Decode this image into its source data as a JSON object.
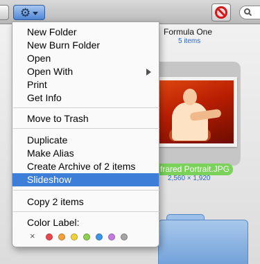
{
  "folder": {
    "name": "Formula One",
    "count": "5 items"
  },
  "hidden_text": "ts",
  "file": {
    "label": "frared Portrait.JPG",
    "dimensions": "2,560 × 1,920"
  },
  "menu": {
    "items": [
      {
        "label": "New Folder"
      },
      {
        "label": "New Burn Folder"
      },
      {
        "label": "Open"
      },
      {
        "label": "Open With",
        "submenu": true
      },
      {
        "label": "Print"
      },
      {
        "label": "Get Info"
      },
      {
        "label": "Move to Trash"
      },
      {
        "label": "Duplicate"
      },
      {
        "label": "Make Alias"
      },
      {
        "label": "Create Archive of 2 items"
      },
      {
        "label": "Slideshow",
        "selected": true
      },
      {
        "label": "Copy 2 items"
      },
      {
        "label": "Color Label:"
      }
    ],
    "color_label_clear": "×",
    "color_labels": [
      {
        "name": "red",
        "color": "#e8474c"
      },
      {
        "name": "orange",
        "color": "#f5a23a"
      },
      {
        "name": "yellow",
        "color": "#f0d33c"
      },
      {
        "name": "green",
        "color": "#8fd14e"
      },
      {
        "name": "blue",
        "color": "#3d97e8"
      },
      {
        "name": "purple",
        "color": "#c37be0"
      },
      {
        "name": "gray",
        "color": "#a6a6a6"
      }
    ]
  },
  "colors": {
    "selection": "#3d7fd8",
    "file_label": "#7ad25a",
    "meta_text": "#2a66c8"
  }
}
